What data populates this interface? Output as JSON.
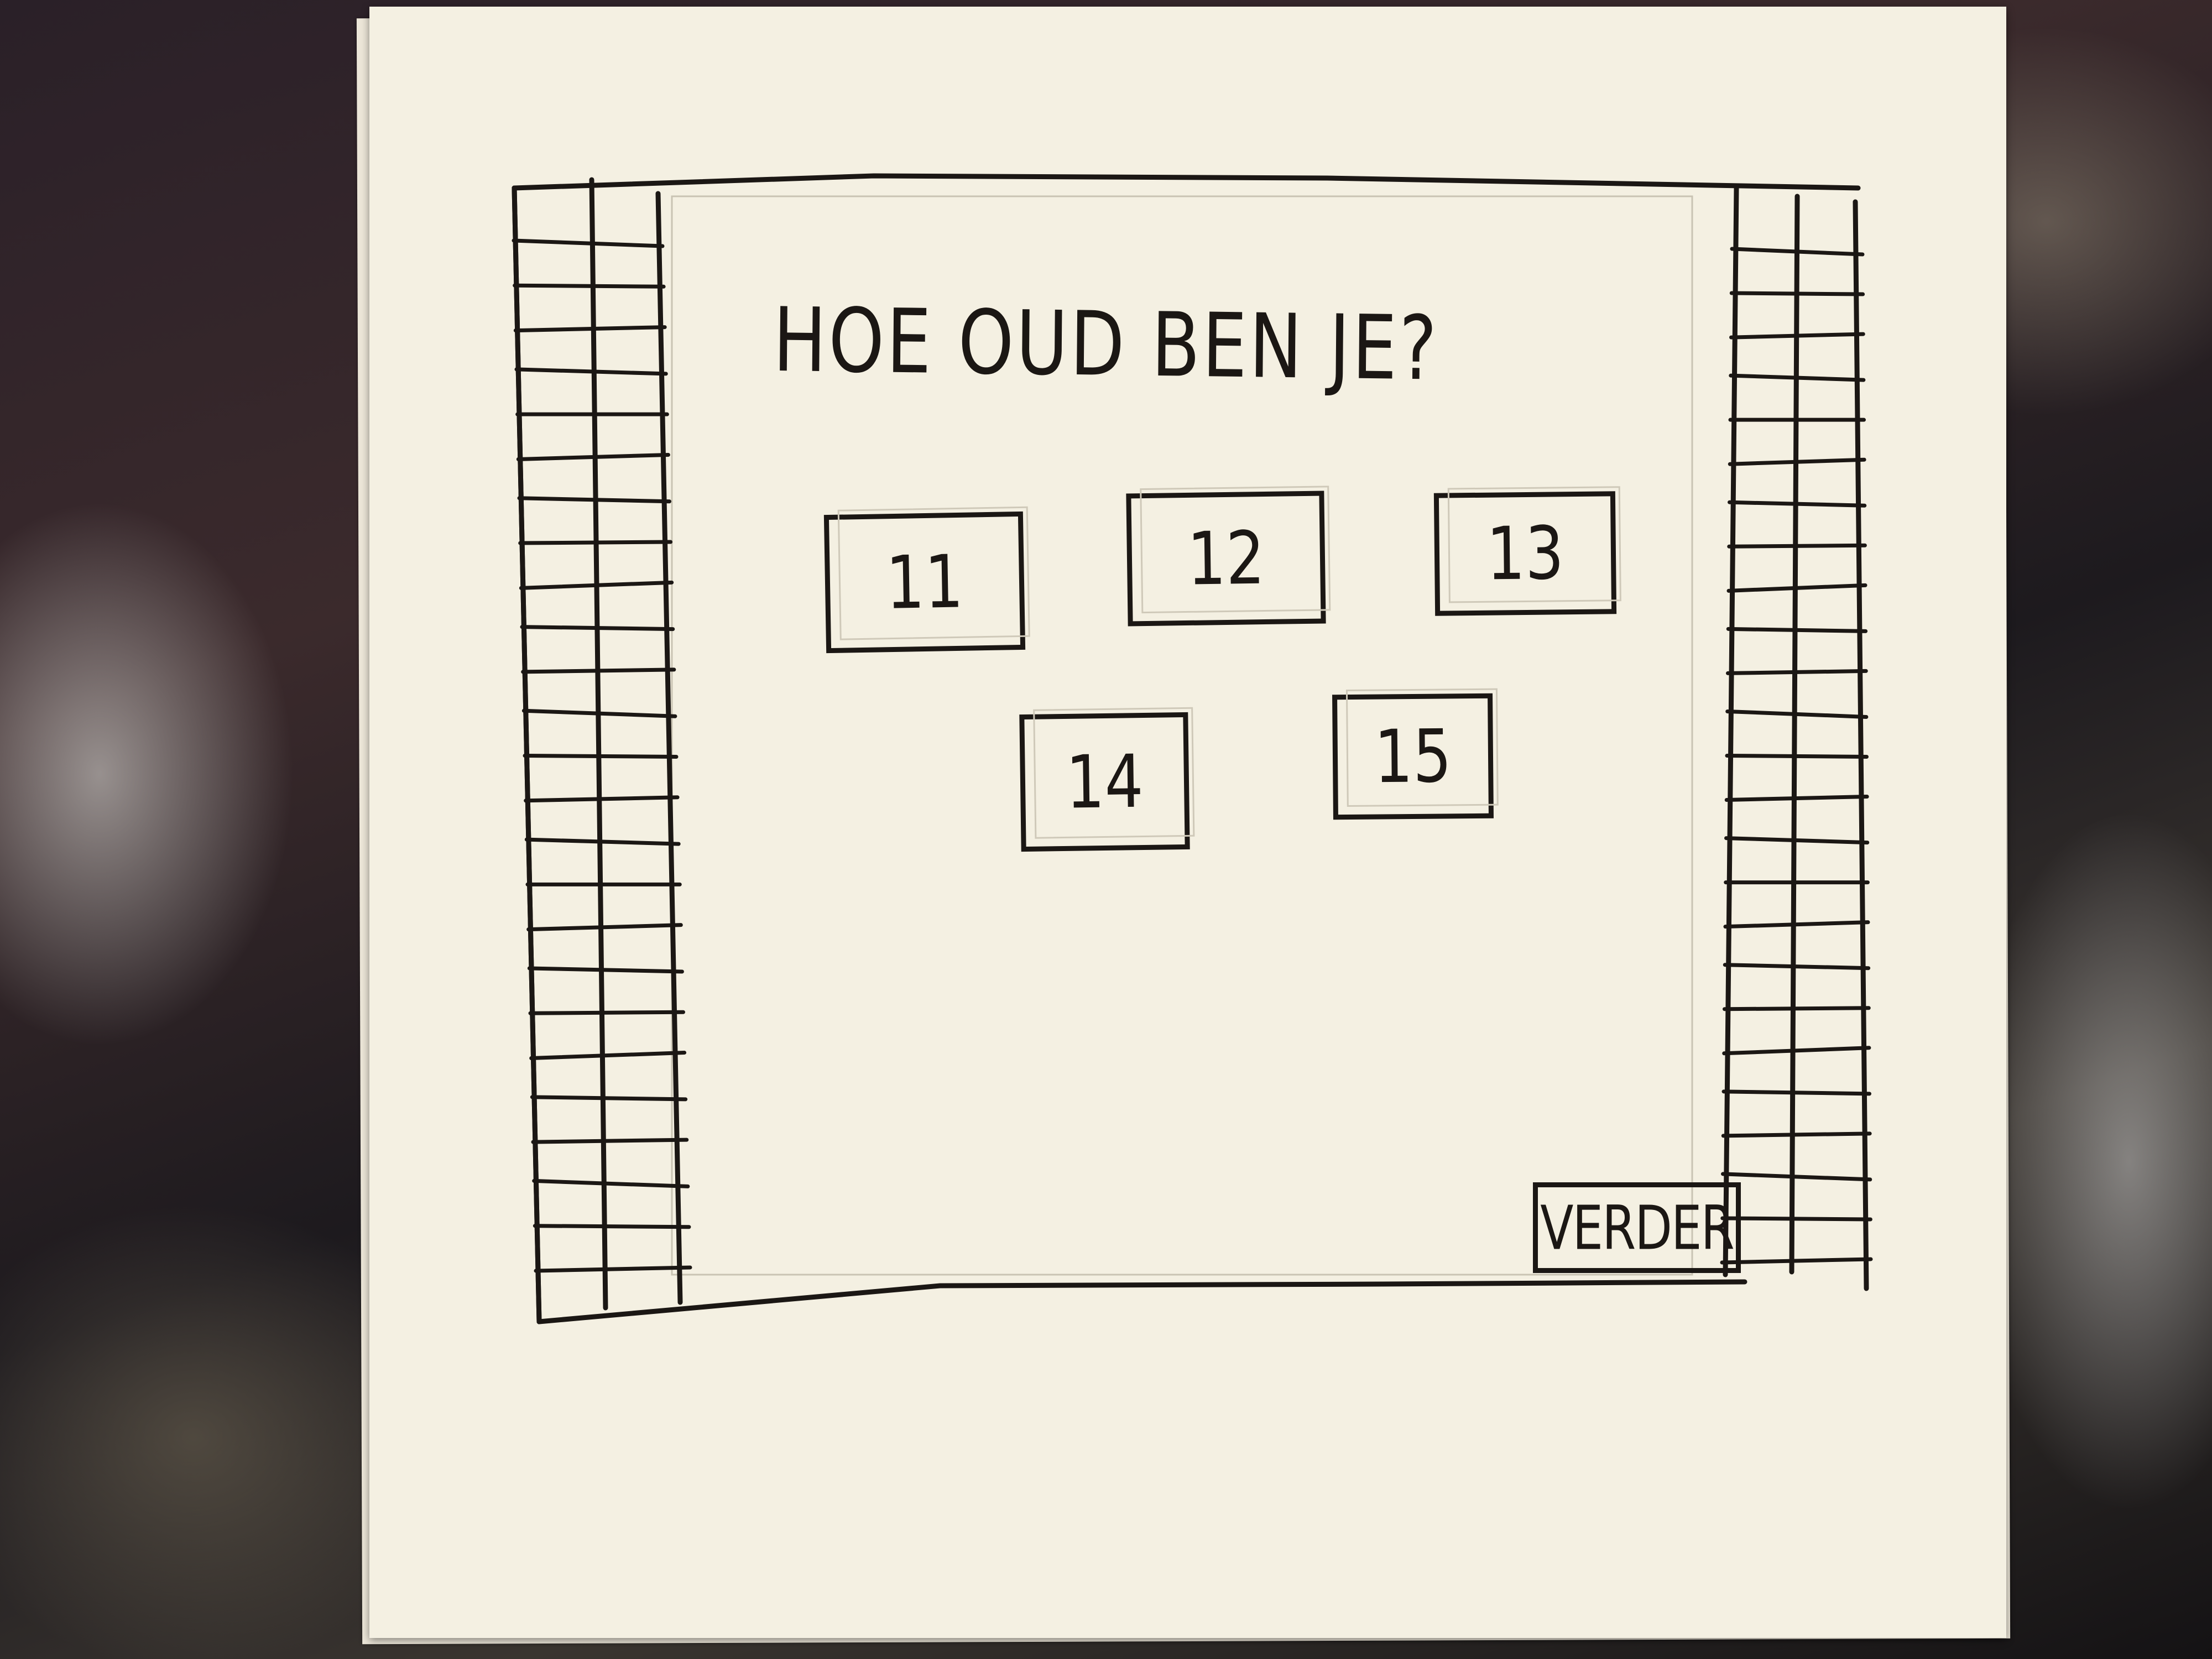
{
  "screen": {
    "question": "HOE OUD BEN JE?",
    "age_options": [
      {
        "label": "11"
      },
      {
        "label": "12"
      },
      {
        "label": "13"
      },
      {
        "label": "14"
      },
      {
        "label": "15"
      }
    ],
    "next_button": "VERDER"
  },
  "colors": {
    "ink": "#1b1714",
    "paper": "#f4f0e2",
    "pencil": "#c9c3b3"
  },
  "icons": {
    "left_panel": "grid-list",
    "right_panel": "grid-list"
  }
}
